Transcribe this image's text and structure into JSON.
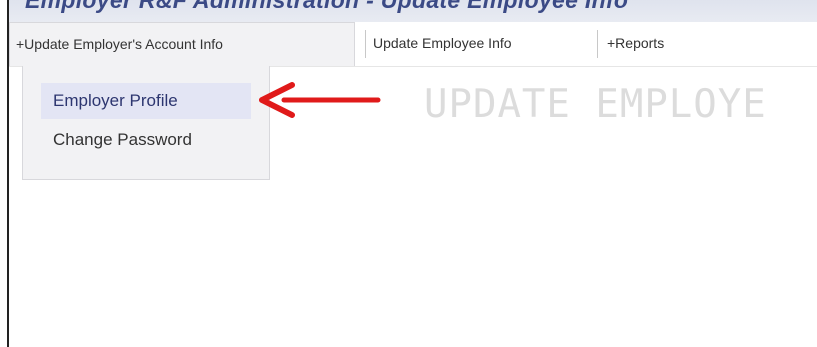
{
  "header": {
    "title": "Employer R&F Administration - Update Employee Info"
  },
  "menubar": {
    "items": [
      {
        "label": "+Update Employer's Account Info",
        "active": true
      },
      {
        "label": "Update Employee Info",
        "active": false
      },
      {
        "label": "+Reports",
        "active": false
      }
    ]
  },
  "dropdown": {
    "items": [
      {
        "label": "Employer Profile",
        "highlighted": true
      },
      {
        "label": "Change Password",
        "highlighted": false
      }
    ]
  },
  "main": {
    "heading": "UPDATE EMPLOYE"
  },
  "annotation": {
    "arrow_color": "#e01a1a"
  },
  "colors": {
    "title": "#3b4a86",
    "highlight": "#e3e5f4"
  }
}
